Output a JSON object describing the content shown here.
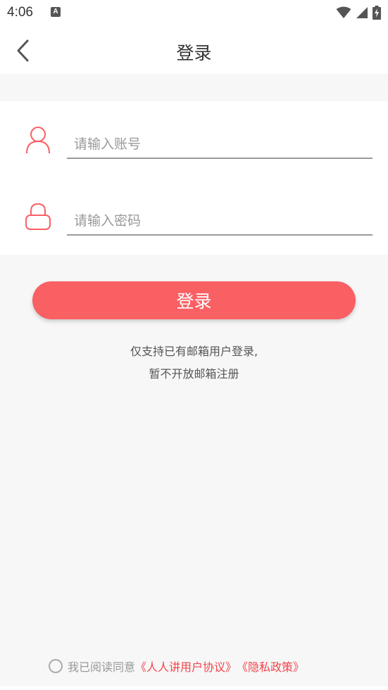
{
  "status_bar": {
    "time": "4:06",
    "notification_badge": "A"
  },
  "nav": {
    "title": "登录"
  },
  "form": {
    "account_placeholder": "请输入账号",
    "password_placeholder": "请输入密码"
  },
  "login_button": {
    "label": "登录"
  },
  "notice": {
    "line1": "仅支持已有邮箱用户登录,",
    "line2": "暂不开放邮箱注册"
  },
  "agreement": {
    "text": "我已阅读同意",
    "user_agreement_link": "《人人讲用户协议》",
    "privacy_link": "《隐私政策》"
  },
  "colors": {
    "accent": "#f96064",
    "link": "#f4444c",
    "background": "#f7f7f7"
  }
}
